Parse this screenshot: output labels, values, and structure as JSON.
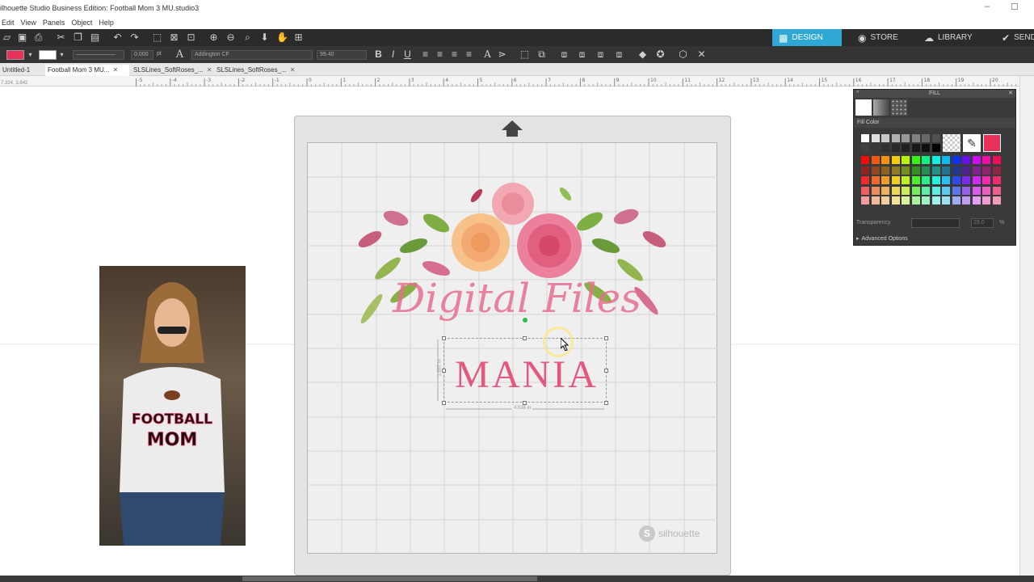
{
  "window": {
    "title": "ilhouette Studio Business Edition: Football Mom 3 MU.studio3",
    "minimize": "–",
    "maximize": "☐"
  },
  "menu": [
    "Edit",
    "View",
    "Panels",
    "Object",
    "Help"
  ],
  "navtabs": {
    "design": "DESIGN",
    "store": "STORE",
    "library": "LIBRARY",
    "send": "SEND"
  },
  "toolbar": {
    "line_weight": "0.000",
    "line_unit": "pt",
    "font_name": "Addington CF",
    "font_size": "99.40",
    "fill_color": "#e6325a",
    "line_color": "#ffffff"
  },
  "doc_tabs": [
    {
      "label": "Untitled-1"
    },
    {
      "label": "Football Mom 3 MU..."
    },
    {
      "label": "SLSLines_SoftRoses_..."
    },
    {
      "label": "SLSLines_SoftRoses_..."
    }
  ],
  "ruler": {
    "coords": "7.324, 3.842",
    "labels": [
      "0",
      "1",
      "2",
      "3",
      "4",
      "5",
      "6",
      "7",
      "8",
      "9",
      "10",
      "11",
      "12",
      "13",
      "14",
      "15",
      "16",
      "17",
      "18",
      "19",
      "20"
    ],
    "neg_labels": [
      "-5",
      "-4",
      "-3",
      "-2",
      "-1"
    ]
  },
  "design": {
    "text_top": "Digital Files",
    "text_bottom": "MANIA",
    "width_dim": "4.535 in",
    "height_dim": "1.657 in",
    "brand": "silhouette",
    "brand_mark": "S",
    "shirt_top": "FOOTBALL",
    "shirt_bottom": "MOM"
  },
  "fill_panel": {
    "title": "FILL",
    "section": "Fill Color",
    "transparency_label": "Transparency",
    "transparency_value": "29.0",
    "transparency_unit": "%",
    "advanced": "Advanced Options",
    "selected_color": "#e6325a"
  }
}
